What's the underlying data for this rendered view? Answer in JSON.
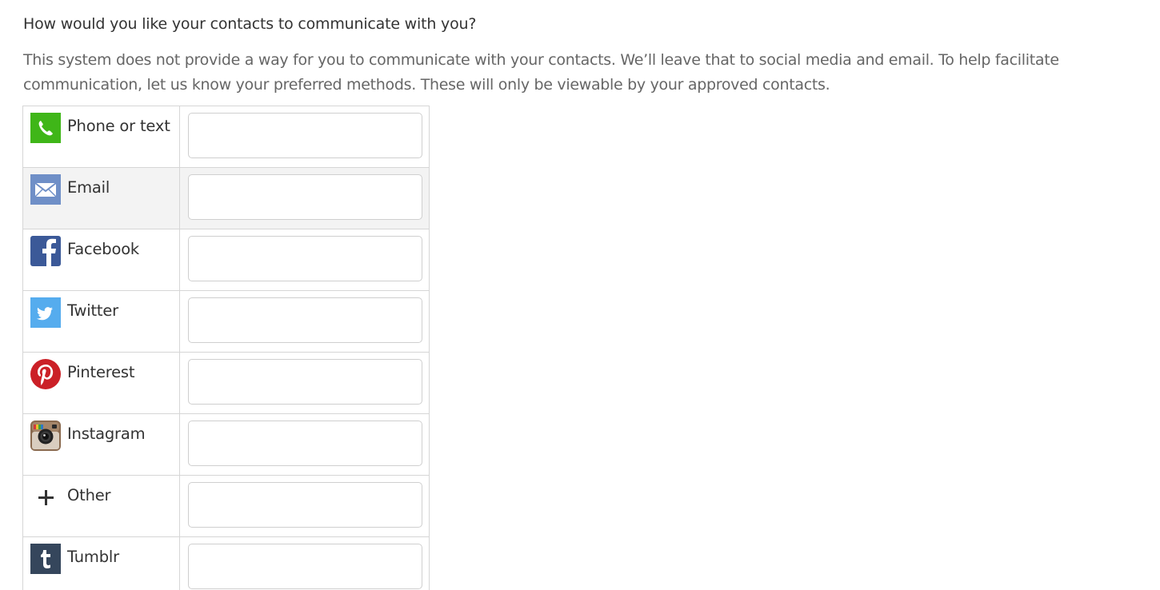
{
  "question": "How would you like your contacts to communicate with you?",
  "description": {
    "line1": "This system does not provide a way for you to communicate with your contacts. We’ll leave that to social media and email. To help facilitate",
    "line2": "communication, let us know your preferred methods. These will only be viewable by your approved contacts."
  },
  "methods": [
    {
      "label": "Phone or text",
      "icon": "phone-icon",
      "value": "",
      "color": "#3fb618"
    },
    {
      "label": "Email",
      "icon": "envelope-icon",
      "value": "",
      "color": "#6f8fc7"
    },
    {
      "label": "Facebook",
      "icon": "facebook-icon",
      "value": "",
      "color": "#3b5998"
    },
    {
      "label": "Twitter",
      "icon": "twitter-icon",
      "value": "",
      "color": "#55acee"
    },
    {
      "label": "Pinterest",
      "icon": "pinterest-icon",
      "value": "",
      "color": "#cb2027"
    },
    {
      "label": "Instagram",
      "icon": "instagram-icon",
      "value": "",
      "color": "#8a6a4f"
    },
    {
      "label": "Other",
      "icon": "plus-icon",
      "value": "",
      "color": "#333333"
    },
    {
      "label": "Tumblr",
      "icon": "tumblr-icon",
      "value": "",
      "color": "#35465c"
    }
  ]
}
